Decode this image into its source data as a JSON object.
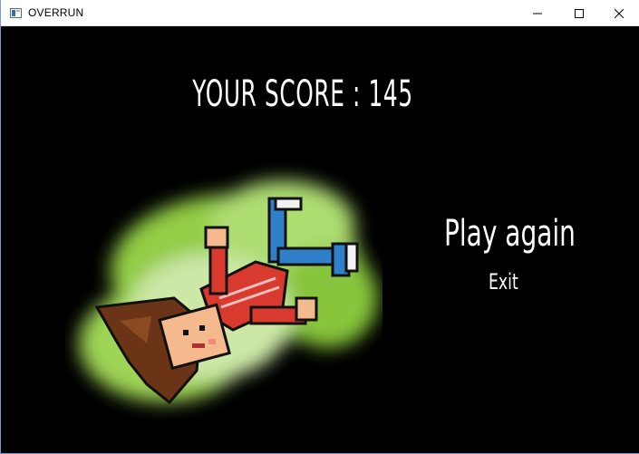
{
  "window": {
    "title": "OVERRUN",
    "controls": {
      "minimize_icon": "minimize-icon",
      "maximize_icon": "maximize-icon",
      "close_icon": "close-icon"
    }
  },
  "game": {
    "score_text": "YOUR SCORE : 145",
    "menu": {
      "play_again": "Play again",
      "exit": "Exit"
    },
    "sprite": "fallen-player-character",
    "colors": {
      "background": "#000000",
      "text": "#ffffff",
      "glow": "#9bd84a",
      "shirt": "#d83a2e",
      "pants": "#2f7fc9",
      "hair": "#6b3416",
      "skin": "#f4b98c"
    }
  }
}
